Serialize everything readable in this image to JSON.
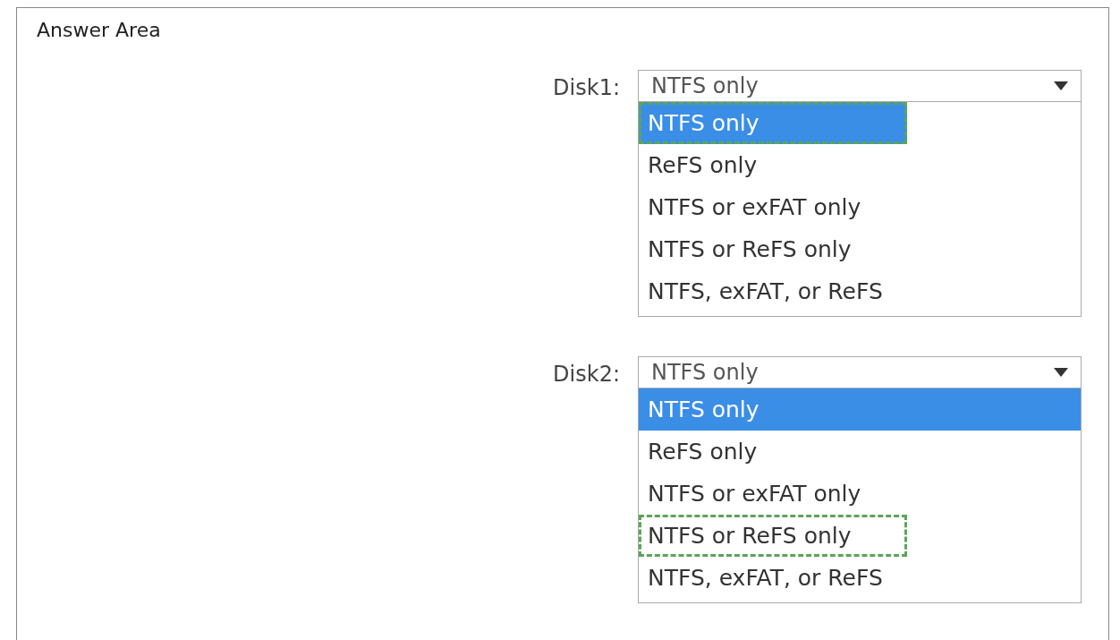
{
  "title": "Answer Area",
  "disks": [
    {
      "label": "Disk1:",
      "value": "NTFS only",
      "options": [
        {
          "text": "NTFS only",
          "selected": true,
          "answer": true
        },
        {
          "text": "ReFS only",
          "selected": false,
          "answer": false
        },
        {
          "text": "NTFS or exFAT only",
          "selected": false,
          "answer": false
        },
        {
          "text": "NTFS or ReFS only",
          "selected": false,
          "answer": false
        },
        {
          "text": "NTFS, exFAT, or ReFS",
          "selected": false,
          "answer": false
        }
      ]
    },
    {
      "label": "Disk2:",
      "value": "NTFS only",
      "options": [
        {
          "text": "NTFS only",
          "selected": true,
          "answer": false
        },
        {
          "text": "ReFS only",
          "selected": false,
          "answer": false
        },
        {
          "text": "NTFS or exFAT only",
          "selected": false,
          "answer": false
        },
        {
          "text": "NTFS or ReFS only",
          "selected": false,
          "answer": true
        },
        {
          "text": "NTFS, exFAT, or ReFS",
          "selected": false,
          "answer": false
        }
      ]
    }
  ]
}
